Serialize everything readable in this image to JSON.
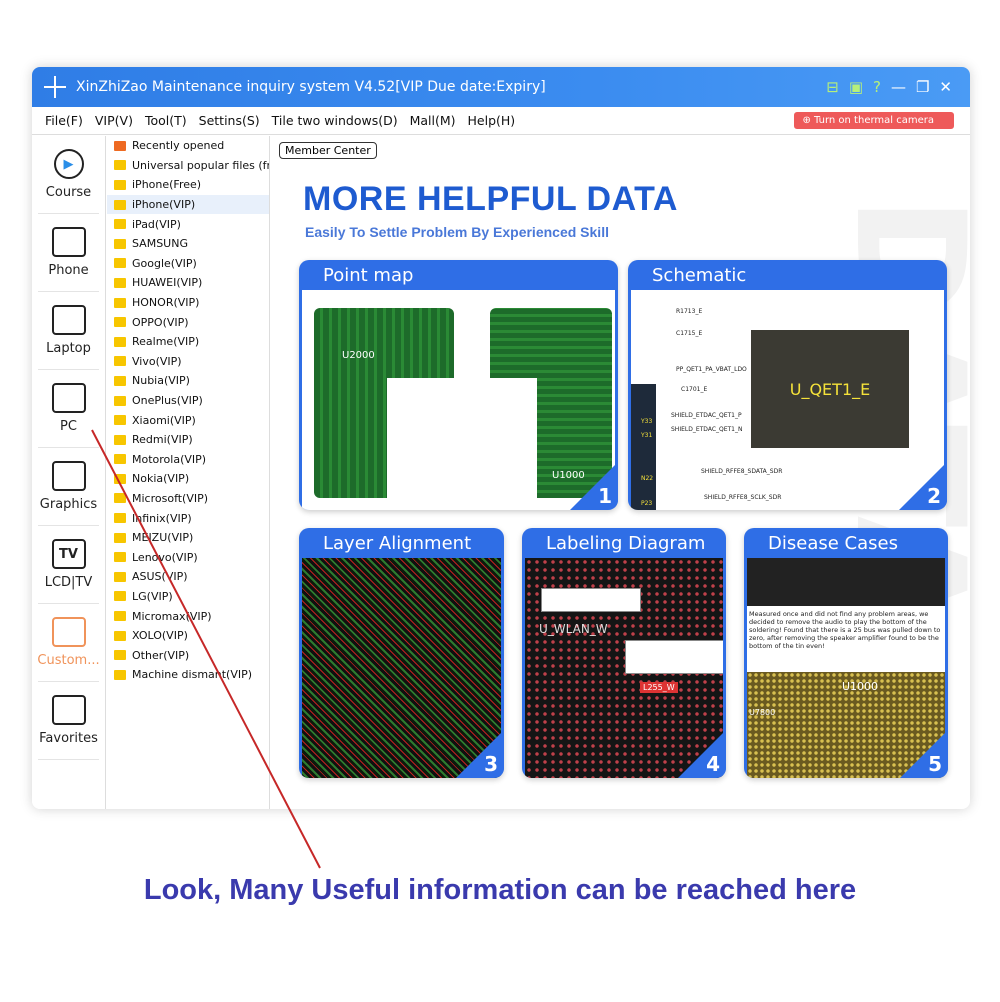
{
  "window": {
    "title": "XinZhiZao Maintenance inquiry system V4.52[VIP Due date:Expiry]",
    "controls": [
      "minimize",
      "restore",
      "close"
    ]
  },
  "menu": {
    "items": [
      "File(F)",
      "VIP(V)",
      "Tool(T)",
      "Settins(S)",
      "Tile two windows(D)",
      "Mall(M)",
      "Help(H)"
    ],
    "thermal_button": "Turn on thermal camera"
  },
  "sidebar": {
    "items": [
      {
        "label": "Course",
        "icon": "play-icon"
      },
      {
        "label": "Phone",
        "icon": "phone-icon"
      },
      {
        "label": "Laptop",
        "icon": "laptop-icon"
      },
      {
        "label": "PC",
        "icon": "motherboard-icon"
      },
      {
        "label": "Graphics",
        "icon": "graphics-card-icon"
      },
      {
        "label": "LCD|TV",
        "icon": "tv-icon",
        "glyph": "TV"
      },
      {
        "label": "Custom...",
        "icon": "pencil-ruler-icon"
      },
      {
        "label": "Favorites",
        "icon": "heart-folder-icon"
      }
    ]
  },
  "tree": {
    "items": [
      "Recently opened",
      "Universal popular files (free",
      "iPhone(Free)",
      "iPhone(VIP)",
      "iPad(VIP)",
      "SAMSUNG",
      "Google(VIP)",
      "HUAWEI(VIP)",
      "HONOR(VIP)",
      "OPPO(VIP)",
      "Realme(VIP)",
      "Vivo(VIP)",
      "Nubia(VIP)",
      "OnePlus(VIP)",
      "Xiaomi(VIP)",
      "Redmi(VIP)",
      "Motorola(VIP)",
      "Nokia(VIP)",
      "Microsoft(VIP)",
      "Infinix(VIP)",
      "MEIZU(VIP)",
      "Lenovo(VIP)",
      "ASUS(VIP)",
      "LG(VIP)",
      "Micromax(VIP)",
      "XOLO(VIP)",
      "Other(VIP)",
      "Machine dismant(VIP)"
    ],
    "selected": "iPhone(VIP)"
  },
  "main": {
    "member_center": "Member Center",
    "watermark": "DATA",
    "heading": "MORE HELPFUL DATA",
    "subheading": "Easily To Settle Problem By Experienced Skill",
    "cards": [
      {
        "title": "Point map",
        "number": "1",
        "labels": [
          "U2000",
          "U1000"
        ]
      },
      {
        "title": "Schematic",
        "number": "2",
        "labels": [
          "U_QET1_E",
          "R1713_E",
          "C1715_E",
          "C1701_E",
          "PP_QET1_PA_VBAT_LDO",
          "SHIELD_ETDAC_QET1_P",
          "SHIELD_ETDAC_QET1_N",
          "SHIELD_RFFE8_SDATA_SDR",
          "SHIELD_RFFE8_SCLK_SDR",
          "Y33",
          "Y31",
          "N22",
          "P23"
        ]
      },
      {
        "title": "Layer Alignment",
        "number": "3"
      },
      {
        "title": "Labeling Diagram",
        "number": "4",
        "labels": [
          "U_WLAN_W",
          "L255_W"
        ]
      },
      {
        "title": "Disease Cases",
        "number": "5",
        "labels": [
          "U1000",
          "U7800"
        ],
        "caption": "Measured once and did not find any problem areas, we decided to remove the audio to play the bottom of the soldering! Found that there is a 25 bus was pulled down to zero, after removing the speaker amplifier found to be the bottom of the tin even!"
      }
    ]
  },
  "footer": {
    "text": "Look, Many Useful information can be reached here"
  },
  "colors": {
    "titlebar": "#3b8cf0",
    "accent": "#2f6ee6",
    "heading": "#1e5bd0",
    "footer": "#3a3aad",
    "annotation_line": "#c62828",
    "thermal": "#ee5a5a"
  }
}
